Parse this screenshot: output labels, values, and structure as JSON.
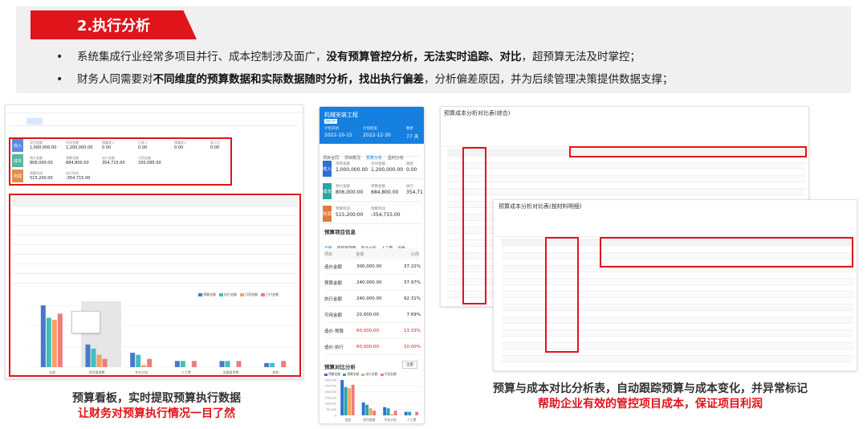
{
  "heading": "2.执行分析",
  "bullets": [
    {
      "pre": "系统集成行业经常多项目并行、成本控制涉及面广，",
      "bold": "没有预算管控分析，无法实时追踪、对比",
      "post": "，超预算无法及时掌控；"
    },
    {
      "pre": "财务人同需要对",
      "bold": "不同维度的预算数据和实际数据随时分析，找出执行偏差",
      "post": "，分析偏差原因，并为后续管理决策提供数据支撑；"
    }
  ],
  "left": {
    "kpis": [
      {
        "side": "收入",
        "items": [
          {
            "label": "项目金额",
            "value": "1,000,000.00"
          },
          {
            "label": "合同金额",
            "value": "1,200,000.00"
          },
          {
            "label": "预算收入",
            "value": "0.00"
          },
          {
            "label": "已收入",
            "value": "0.00"
          },
          {
            "label": "预算收入",
            "value": "0.00"
          },
          {
            "label": "收入比",
            "value": "0.00"
          }
        ]
      },
      {
        "side": "成本",
        "items": [
          {
            "label": "预计金额",
            "value": "806,000.00"
          },
          {
            "label": "预算金额",
            "value": "684,800.00"
          },
          {
            "label": "执行金额",
            "value": "354,715.00"
          },
          {
            "label": "可用金额",
            "value": "330,085.00"
          }
        ]
      },
      {
        "side": "利润",
        "items": [
          {
            "label": "预算利润",
            "value": "515,200.00"
          },
          {
            "label": "执行利润",
            "value": "-354,715.00"
          }
        ]
      }
    ],
    "chart_data": {
      "type": "bar",
      "title": "",
      "categories": [
        "全部",
        "项目管理费",
        "专业分包",
        "人工费",
        "设备租赁费",
        "其他"
      ],
      "series": [
        {
          "name": "预算金额",
          "color": "#4a78c8",
          "values": [
            300000,
            110000,
            70000,
            30000,
            30000,
            20000
          ]
        },
        {
          "name": "执行金额",
          "color": "#3fbfbf",
          "values": [
            240000,
            90000,
            60000,
            30000,
            30000,
            20000
          ]
        },
        {
          "name": "可用金额",
          "color": "#f4a261",
          "values": [
            230000,
            60000,
            10000,
            0,
            0,
            0
          ]
        },
        {
          "name": "已付金额",
          "color": "#f07c7c",
          "values": [
            260000,
            40000,
            40000,
            30000,
            30000,
            30000
          ]
        }
      ],
      "ylim": [
        0,
        320000
      ]
    },
    "caption1": "预算看板，实时提取预算执行数据",
    "caption2": "让财务对预算执行情况一目了然"
  },
  "middle": {
    "project": "机械安装工程",
    "tag": "执行中",
    "start_label": "计划开始",
    "start": "2022-10-15",
    "end_label": "计划结束",
    "end": "2022-12-30",
    "days_label": "剩余",
    "days": "77 天",
    "tabs": [
      "项目合同",
      "项目概况",
      "预算分析",
      "盈利分析",
      "单据"
    ],
    "kpis": [
      {
        "side": "收入",
        "color": "#2f6fd6",
        "l1": "项目金额",
        "v1": "1,000,000.00",
        "l2": "合同金额",
        "v2": "1,200,000.00",
        "l3": "收款",
        "v3": "0.00"
      },
      {
        "side": "成本",
        "color": "#27a6a6",
        "l1": "预计金额",
        "v1": "806,000.00",
        "l2": "预算金额",
        "v2": "684,800.00",
        "l3": "执行",
        "v3": "354,71"
      },
      {
        "side": "利润",
        "color": "#e07b36",
        "l1": "预算利润",
        "v1": "515,200.00",
        "l2": "预算利润",
        "v2": "-354,715.00",
        "l3": "",
        "v3": ""
      }
    ],
    "budget_title": "预算项目信息",
    "budget_tabs": [
      "全部",
      "项目管理费",
      "专业分包",
      "人工费",
      "设备"
    ],
    "table_head": [
      "项目",
      "金额",
      "比例"
    ],
    "table_rows": [
      {
        "c1": "造价金额",
        "c2": "300,000.00",
        "c3": "37.22%",
        "red": false
      },
      {
        "c1": "预算金额",
        "c2": "240,000.00",
        "c3": "37.97%",
        "red": false
      },
      {
        "c1": "执行金额",
        "c2": "240,000.00",
        "c3": "92.31%",
        "red": false
      },
      {
        "c1": "可用金额",
        "c2": "20,000.00",
        "c3": "7.69%",
        "red": false
      },
      {
        "c1": "造价-预算",
        "c2": "60,000.00",
        "c3": "13.33%",
        "red": true
      },
      {
        "c1": "造价-执行",
        "c2": "60,000.00",
        "c3": "20.00%",
        "red": true
      }
    ],
    "chart_title": "预算对比分析",
    "chart_btn": "全部",
    "legend": [
      "预算金额",
      "预算金额",
      "执行金额",
      "可用金额"
    ],
    "ticks": [
      "300,000",
      "250,000",
      "200,000",
      "150,000",
      "100,000",
      "50,000",
      "0"
    ],
    "xcats": [
      "全部",
      "项目管理",
      "专业分包",
      "人工费"
    ]
  },
  "right": {
    "title_back": "预算成本分析对比表(综合)",
    "title_front": "预算成本分析对比表(按材料明细)",
    "caption1": "预算与成本对比分析表，自动跟踪预算与成本变化，并异常标记",
    "caption2": "帮助企业有效的管控项目成本，保证项目利润"
  }
}
